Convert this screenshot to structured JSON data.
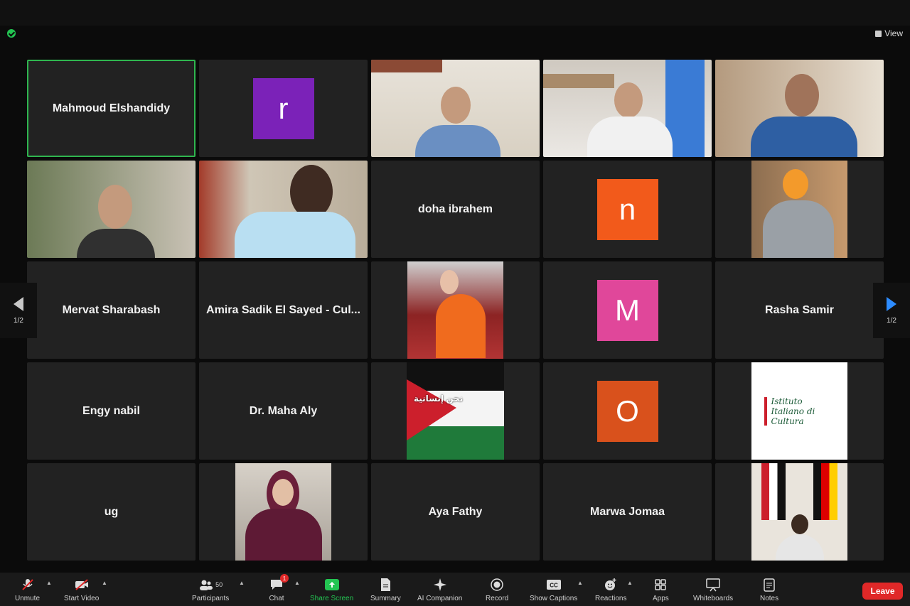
{
  "app": {
    "view_label": "View"
  },
  "pager": {
    "left_page": "1/2",
    "right_page": "1/2"
  },
  "participants": [
    {
      "name": "Mahmoud Elshandidy",
      "kind": "name",
      "active": true
    },
    {
      "name": "",
      "kind": "avatar",
      "letter": "r",
      "color": "#7b22b8"
    },
    {
      "name": "",
      "kind": "video"
    },
    {
      "name": "",
      "kind": "video"
    },
    {
      "name": "",
      "kind": "video"
    },
    {
      "name": "",
      "kind": "video"
    },
    {
      "name": "",
      "kind": "video"
    },
    {
      "name": "doha ibrahem",
      "kind": "name"
    },
    {
      "name": "",
      "kind": "avatar",
      "letter": "n",
      "color": "#f25a1b"
    },
    {
      "name": "",
      "kind": "photo"
    },
    {
      "name": "Mervat Sharabash",
      "kind": "name"
    },
    {
      "name": "Amira Sadik El Sayed - Cul...",
      "kind": "name"
    },
    {
      "name": "",
      "kind": "photo"
    },
    {
      "name": "",
      "kind": "avatar",
      "letter": "M",
      "color": "#e0479a"
    },
    {
      "name": "Rasha Samir",
      "kind": "name"
    },
    {
      "name": "Engy nabil",
      "kind": "name"
    },
    {
      "name": "Dr. Maha Aly",
      "kind": "name"
    },
    {
      "name": "",
      "kind": "photo",
      "caption": "نحن إنسانية"
    },
    {
      "name": "",
      "kind": "avatar",
      "letter": "O",
      "color": "#d9511c"
    },
    {
      "name": "",
      "kind": "photo",
      "caption": "Istituto Italiano di Cultura"
    },
    {
      "name": "ug",
      "kind": "name"
    },
    {
      "name": "",
      "kind": "photo"
    },
    {
      "name": "Aya Fathy",
      "kind": "name"
    },
    {
      "name": "Marwa Jomaa",
      "kind": "name"
    },
    {
      "name": "",
      "kind": "photo"
    }
  ],
  "toolbar": {
    "unmute": "Unmute",
    "start_video": "Start Video",
    "participants": "Participants",
    "participants_count": "50",
    "chat": "Chat",
    "chat_badge": "1",
    "share_screen": "Share Screen",
    "summary": "Summary",
    "ai_companion": "AI Companion",
    "record": "Record",
    "show_captions": "Show Captions",
    "reactions": "Reactions",
    "apps": "Apps",
    "whiteboards": "Whiteboards",
    "notes": "Notes",
    "leave": "Leave"
  },
  "colors": {
    "accent_green": "#23c552",
    "leave_red": "#e02828",
    "nav_blue": "#2d8cff"
  }
}
